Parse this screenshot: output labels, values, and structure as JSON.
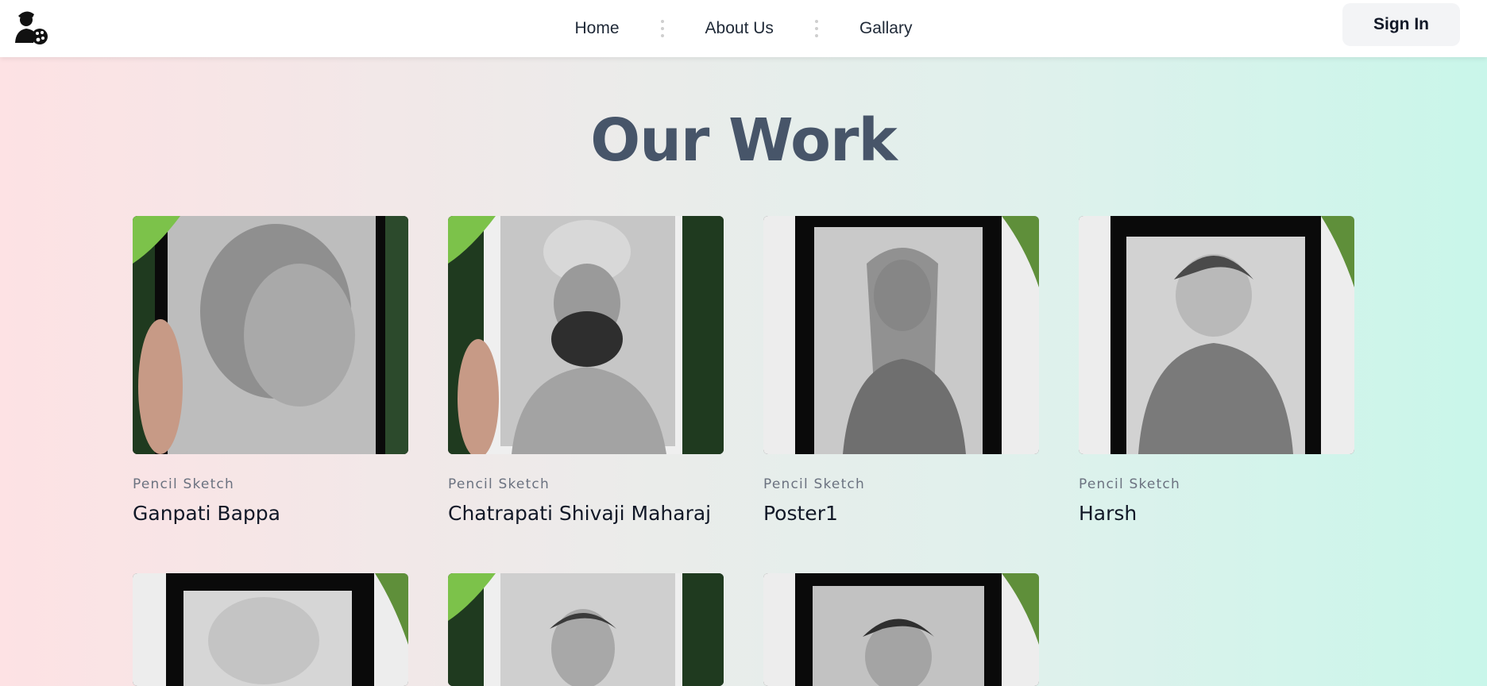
{
  "nav": {
    "links": [
      "Home",
      "About Us",
      "Gallary"
    ],
    "signin_label": "Sign In"
  },
  "heading": "Our Work",
  "works": [
    {
      "category": "Pencil Sketch",
      "title": "Ganpati Bappa"
    },
    {
      "category": "Pencil Sketch",
      "title": "Chatrapati Shivaji Maharaj"
    },
    {
      "category": "Pencil Sketch",
      "title": "Poster1"
    },
    {
      "category": "Pencil Sketch",
      "title": "Harsh"
    },
    {
      "category": "",
      "title": ""
    },
    {
      "category": "",
      "title": ""
    },
    {
      "category": "",
      "title": ""
    }
  ]
}
